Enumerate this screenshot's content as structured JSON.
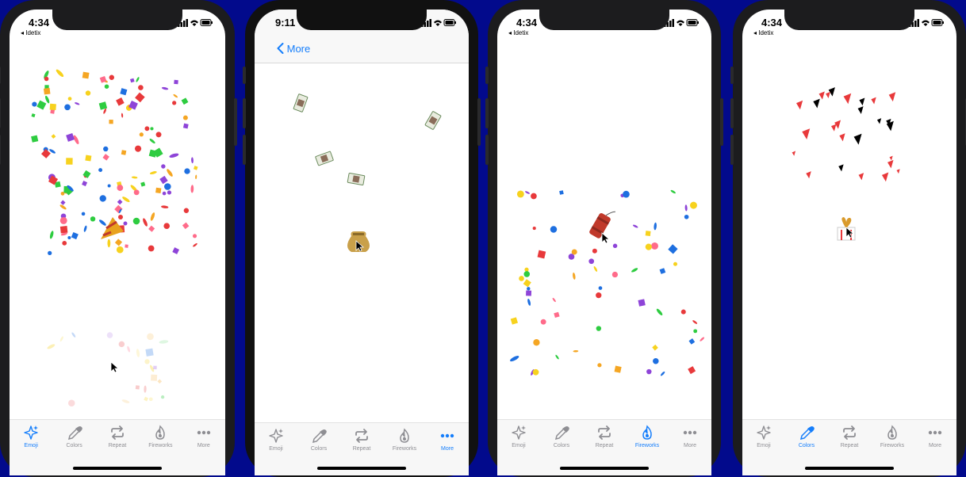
{
  "screens": [
    {
      "id": "emoji",
      "time": "4:34",
      "back_app": "◂ Idetix",
      "active_tab": 0,
      "dark": false
    },
    {
      "id": "more",
      "time": "9:11",
      "back_label": "More",
      "active_tab": 4,
      "dark": true
    },
    {
      "id": "fireworks",
      "time": "4:34",
      "back_app": "◂ Idetix",
      "active_tab": 3,
      "dark": false
    },
    {
      "id": "colors",
      "time": "4:34",
      "back_app": "◂ Idetix",
      "active_tab": 1,
      "dark": false
    }
  ],
  "tabs": [
    {
      "label": "Emoji",
      "icon": "sparkles-icon"
    },
    {
      "label": "Colors",
      "icon": "eyedropper-icon"
    },
    {
      "label": "Repeat",
      "icon": "repeat-icon"
    },
    {
      "label": "Fireworks",
      "icon": "flame-icon"
    },
    {
      "label": "More",
      "icon": "ellipsis-icon"
    }
  ],
  "emitters": [
    "party-popper-icon",
    "money-bag-icon",
    "firecracker-icon",
    "gift-icon"
  ],
  "colors": {
    "accent": "#157efb",
    "inactive": "#8e8e93",
    "background": "#020a8c",
    "confetti": [
      "#f5a623",
      "#e8393b",
      "#8e44d8",
      "#2ecc40",
      "#1e6fe0",
      "#f7d21e",
      "#ff6b8a"
    ]
  }
}
